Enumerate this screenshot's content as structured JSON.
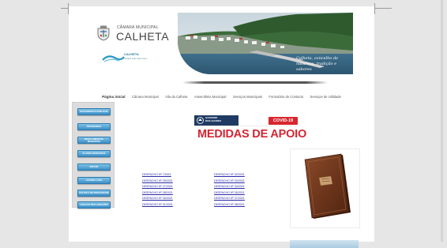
{
  "header": {
    "logo_small": "CÂMARA MUNICIPAL",
    "logo_big": "CALHETA",
    "logo_secondary": "CALHETA",
    "logo_secondary_sub": "Município onde tudo é bom",
    "hero_caption": "Calheta, concelho de natureza, tradição e sabores"
  },
  "nav": [
    {
      "label": "Página inicial",
      "active": true
    },
    {
      "label": "Câmara Municipal"
    },
    {
      "label": "Vila da Calheta"
    },
    {
      "label": "Assembleia Municipal"
    },
    {
      "label": "Serviços Municipais"
    },
    {
      "label": "Formulário de Contacto"
    },
    {
      "label": "Serviços de Utilidade"
    }
  ],
  "sidebar": [
    {
      "label": "DOCUMENTOS PÚBLICOS"
    },
    {
      "label": "PROGRAMAS"
    },
    {
      "label": "REGULAMENTOS MUNICIPAIS"
    },
    {
      "label": "PLANOS MUNICIPAIS"
    },
    {
      "label": "EDITAIS"
    },
    {
      "label": "ACORDO CAVE"
    },
    {
      "label": "POLÍTICA DE PRIVACIDADE"
    },
    {
      "label": "LINHA DE RECLAMAÇÕES"
    }
  ],
  "banner": {
    "gov_line1": "GOVERNO",
    "gov_line2": "DOS AÇORES",
    "covid": "COVID-19",
    "title": "MEDIDAS DE APOIO"
  },
  "despachos_left": [
    "DESPACHO Nº 7/2021",
    "DESPACHO Nº 25/2021",
    "DESPACHO Nº 27/2021",
    "DESPACHO Nº 28/2021",
    "DESPACHO Nº 30/2021",
    "DESPACHO Nº 31/2021"
  ],
  "despachos_right": [
    "DESPACHO Nº 32/2021",
    "DESPACHO Nº 33/2021",
    "DESPACHO Nº 34/2021",
    "DESPACHO Nº 35/2021",
    "DESPACHO Nº 37/2021",
    "DESPACHO Nº 38/2021"
  ],
  "colors": {
    "accent_red": "#d32633",
    "button_blue": "#3c8fc7",
    "gov_blue": "#1f3b63",
    "link_blue": "#2a2aa8"
  }
}
